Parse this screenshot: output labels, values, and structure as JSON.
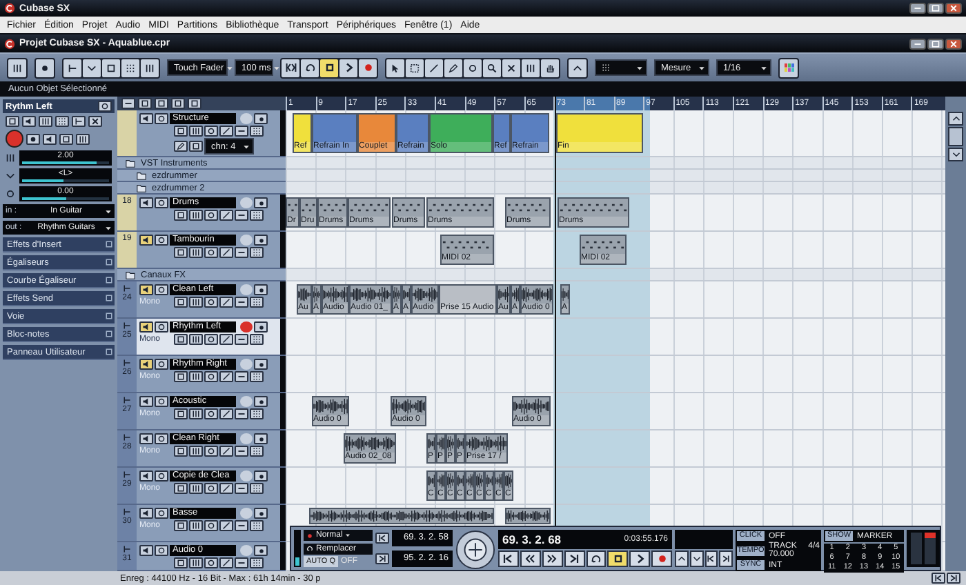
{
  "app_title": "Cubase SX",
  "menu": [
    "Fichier",
    "Édition",
    "Projet",
    "Audio",
    "MIDI",
    "Partitions",
    "Bibliothèque",
    "Transport",
    "Périphériques",
    "Fenêtre (1)",
    "Aide"
  ],
  "project_title": "Projet Cubase SX - Aquablue.cpr",
  "toolbar": {
    "automation_mode": "Touch Fader",
    "preroll": "100 ms",
    "grid_type": "Mesure",
    "quantize": "1/16",
    "transport": [
      {
        "kind": "locate",
        "active": false
      },
      {
        "kind": "cycle",
        "active": false
      },
      {
        "kind": "stop",
        "active": true
      },
      {
        "kind": "play",
        "active": false
      },
      {
        "kind": "record",
        "active": false
      }
    ]
  },
  "info_line": "Aucun Objet Sélectionné",
  "inspector": {
    "track_name": "Rythm Left",
    "record": true,
    "volume": {
      "value": "2.00",
      "level": 0.86
    },
    "pan": {
      "value": "<L>",
      "level": 0.48
    },
    "delay": {
      "value": "0.00",
      "level": 0.5
    },
    "input": {
      "label": "in :",
      "value": "In Guitar"
    },
    "output": {
      "label": "out :",
      "value": "Rhythm Guitars"
    },
    "sections": [
      "Effets d'Insert",
      "Égaliseurs",
      "Courbe Égaliseur",
      "Effets Send",
      "Voie",
      "Bloc-notes",
      "Panneau Utilisateur"
    ]
  },
  "ruler": {
    "cycle_on": true,
    "ticks": [
      "1",
      "9",
      "17",
      "25",
      "33",
      "41",
      "49",
      "57",
      "65",
      "73",
      "81",
      "89",
      "97",
      "105",
      "113",
      "121",
      "129",
      "137",
      "145",
      "153",
      "161",
      "169"
    ]
  },
  "tracks": [
    {
      "kind": "structure",
      "name": "Structure",
      "muted": false,
      "record": false,
      "selected": false,
      "dropdown": "chn: 4",
      "parts": [
        {
          "label": "Ref",
          "color": "#f0e03c"
        },
        {
          "label": "Refrain In",
          "color": "#5a7fc0"
        },
        {
          "label": "Couplet",
          "color": "#e8883a"
        },
        {
          "label": "Refrain",
          "color": "#5a7fc0"
        },
        {
          "label": "Solo",
          "color": "#3eae5a"
        },
        {
          "label": "Ref",
          "color": "#5a7fc0"
        },
        {
          "label": "Refrain",
          "color": "#5a7fc0"
        },
        {
          "label": "Fin",
          "color": "#f0e03c"
        }
      ]
    },
    {
      "kind": "folder",
      "name": "VST Instruments",
      "selected": false,
      "children": [
        {
          "kind": "folder",
          "name": "ezdrummer",
          "selected": false
        },
        {
          "kind": "folder",
          "name": "ezdrummer 2",
          "selected": false
        }
      ]
    },
    {
      "kind": "midi",
      "number": "18",
      "name": "Drums",
      "muted": false,
      "record": false,
      "selected": false,
      "parts": [
        {
          "label": "Dr",
          "muted": false
        },
        {
          "label": "Dru",
          "muted": false
        },
        {
          "label": "Drums",
          "muted": false
        },
        {
          "label": "Drums",
          "muted": false
        },
        {
          "label": "Drums",
          "muted": false
        },
        {
          "label": "Drums",
          "muted": false
        },
        {
          "label": "Drums",
          "muted": false
        },
        {
          "label": "Drums",
          "muted": false
        }
      ]
    },
    {
      "kind": "midi",
      "number": "19",
      "name": "Tambourin",
      "muted": true,
      "record": false,
      "selected": false,
      "parts": [
        {
          "label": "MIDI 02",
          "muted": false
        },
        {
          "label": "MIDI 02",
          "muted": false
        }
      ]
    },
    {
      "kind": "folder",
      "name": "Canaux FX",
      "selected": false
    },
    {
      "kind": "audio",
      "number": "24",
      "name": "Clean Left",
      "channel": "Mono",
      "muted": true,
      "record": false,
      "selected": false,
      "parts": [
        {
          "label": "Au",
          "muted": false
        },
        {
          "label": "A",
          "muted": false
        },
        {
          "label": "Audio",
          "muted": false
        },
        {
          "label": "Audio 01_",
          "muted": false
        },
        {
          "label": "A",
          "muted": false
        },
        {
          "label": "A",
          "muted": false
        },
        {
          "label": "Audio",
          "muted": false
        },
        {
          "label": "Prise 15 Audio",
          "muted": true
        },
        {
          "label": "Au",
          "muted": false
        },
        {
          "label": "A",
          "muted": false
        },
        {
          "label": "Audio 0",
          "muted": false
        },
        {
          "label": "A",
          "muted": false
        }
      ]
    },
    {
      "kind": "audio",
      "number": "25",
      "name": "Rhythm Left",
      "channel": "Mono",
      "muted": true,
      "record": true,
      "selected": true
    },
    {
      "kind": "audio",
      "number": "26",
      "name": "Rhythm Right",
      "channel": "Mono",
      "muted": true,
      "record": false,
      "selected": false
    },
    {
      "kind": "audio",
      "number": "27",
      "name": "Acoustic",
      "channel": "Mono",
      "muted": false,
      "record": false,
      "selected": false,
      "parts": [
        {
          "label": "Audio 0",
          "muted": false
        },
        {
          "label": "Audio 0",
          "muted": false
        },
        {
          "label": "Audio 0",
          "muted": false
        }
      ]
    },
    {
      "kind": "audio",
      "number": "28",
      "name": "Clean Right",
      "channel": "Mono",
      "muted": false,
      "record": false,
      "selected": false,
      "parts": [
        {
          "label": "Audio 02_08",
          "muted": false
        },
        {
          "label": "P",
          "muted": false
        },
        {
          "label": "P",
          "muted": false
        },
        {
          "label": "P",
          "muted": false
        },
        {
          "label": "P",
          "muted": false
        },
        {
          "label": "Prise 17 /",
          "muted": false
        }
      ]
    },
    {
      "kind": "audio",
      "number": "29",
      "name": "Copie de Clea",
      "channel": "Mono",
      "muted": false,
      "record": false,
      "selected": false,
      "parts": [
        {
          "label": "C",
          "muted": false
        },
        {
          "label": "C",
          "muted": false
        },
        {
          "label": "C",
          "muted": false
        },
        {
          "label": "C",
          "muted": false
        },
        {
          "label": "C",
          "muted": false
        },
        {
          "label": "C",
          "muted": false
        },
        {
          "label": "C",
          "muted": false
        },
        {
          "label": "C",
          "muted": false
        },
        {
          "label": "C",
          "muted": false
        }
      ]
    },
    {
      "kind": "audio",
      "number": "30",
      "name": "Basse",
      "channel": "Mono",
      "muted": false,
      "record": false,
      "selected": false,
      "parts": [
        {
          "muted": false
        },
        {
          "muted": false
        }
      ]
    },
    {
      "kind": "audio",
      "number": "31",
      "name": "Audio 0",
      "muted": false,
      "record": false,
      "selected": false
    }
  ],
  "transport": {
    "record_mode": "Normal",
    "cycle_mode": "Remplacer",
    "auto_quantize": "AUTO Q",
    "auto_quantize_state": "OFF",
    "left_locator": "69. 3. 2. 58",
    "right_locator": "95. 2. 2. 16",
    "position": "69. 3. 2. 68",
    "time": "0:03:55.176",
    "buttons": [
      {
        "kind": "to-start",
        "active": false
      },
      {
        "kind": "rewind",
        "active": false
      },
      {
        "kind": "forward",
        "active": false
      },
      {
        "kind": "to-end",
        "active": false
      },
      {
        "kind": "cycle",
        "active": false
      },
      {
        "kind": "stop",
        "active": true
      },
      {
        "kind": "play",
        "active": false
      },
      {
        "kind": "record",
        "active": false
      }
    ],
    "click_label": "CLICK",
    "click": "OFF",
    "tempo_label": "TEMPO",
    "tempo_mode": "TRACK",
    "signature": "4/4",
    "tempo": "70.000",
    "sync_label": "SYNC",
    "sync": "INT",
    "show_label": "SHOW",
    "marker_label": "MARKER",
    "markers": [
      "1",
      "2",
      "3",
      "4",
      "5",
      "6",
      "7",
      "8",
      "9",
      "10",
      "11",
      "12",
      "13",
      "14",
      "15"
    ]
  },
  "status_bar": "Enreg : 44100 Hz - 16 Bit - Max : 61h 14min - 30 p"
}
